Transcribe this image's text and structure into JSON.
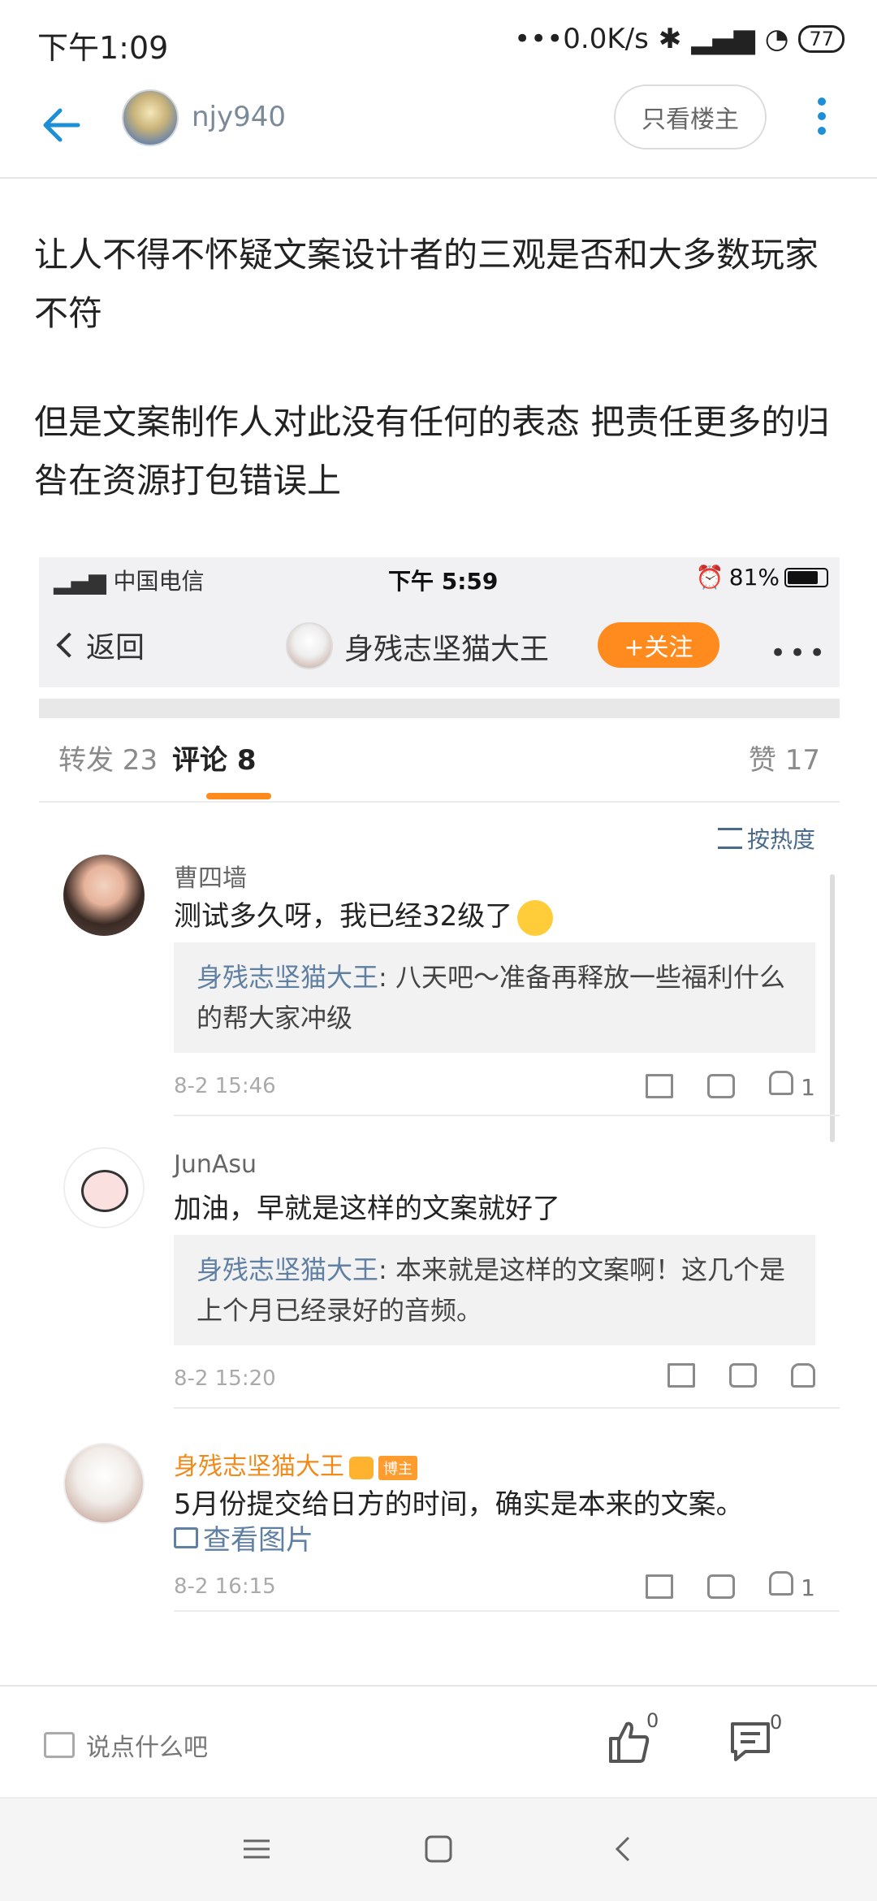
{
  "status_bar": {
    "time": "下午1:09",
    "net_speed": "•••0.0K/s",
    "battery": "77"
  },
  "nav": {
    "username": "njy940",
    "only_op_label": "只看楼主"
  },
  "post": {
    "paragraphs": [
      "让人不得不怀疑文案设计者的三观是否和大多数玩家不符",
      "但是文案制作人对此没有任何的表态 把责任更多的归咎在资源打包错误上"
    ]
  },
  "embedded": {
    "status": {
      "carrier": "中国电信",
      "time": "下午 5:59",
      "battery": "81%"
    },
    "header": {
      "back_label": "返回",
      "name": "身残志坚猫大王",
      "follow_label": "+关注",
      "more": "•••"
    },
    "tabs": [
      {
        "label": "转发 23"
      },
      {
        "label": "评论 8"
      },
      {
        "label": "赞 17"
      }
    ],
    "sort_label": "按热度",
    "comments": [
      {
        "name": "曹四墙",
        "text": "测试多久呀，我已经32级了",
        "reply_name": "身残志坚猫大王",
        "reply_text": ": 八天吧～准备再释放一些福利什么的帮大家冲级",
        "time": "8-2 15:46",
        "likes": "1"
      },
      {
        "name": "JunAsu",
        "text": "加油，早就是这样的文案就好了",
        "reply_name": "身残志坚猫大王",
        "reply_text": ": 本来就是这样的文案啊！这几个是上个月已经录好的音频。",
        "time": "8-2 15:20",
        "likes": ""
      },
      {
        "name": "身残志坚猫大王",
        "tag": "博主",
        "text": "5月份提交给日方的时间，确实是本来的文案。",
        "image_link": "查看图片",
        "time": "8-2 16:15",
        "likes": "1"
      }
    ]
  },
  "bottom_bar": {
    "placeholder": "说点什么吧",
    "like_count": "0",
    "comment_count": "0"
  },
  "colors": {
    "accent_blue": "#1e8fd6",
    "follow_orange": "#ff8b1f",
    "link_blue": "#5f7fa3"
  }
}
